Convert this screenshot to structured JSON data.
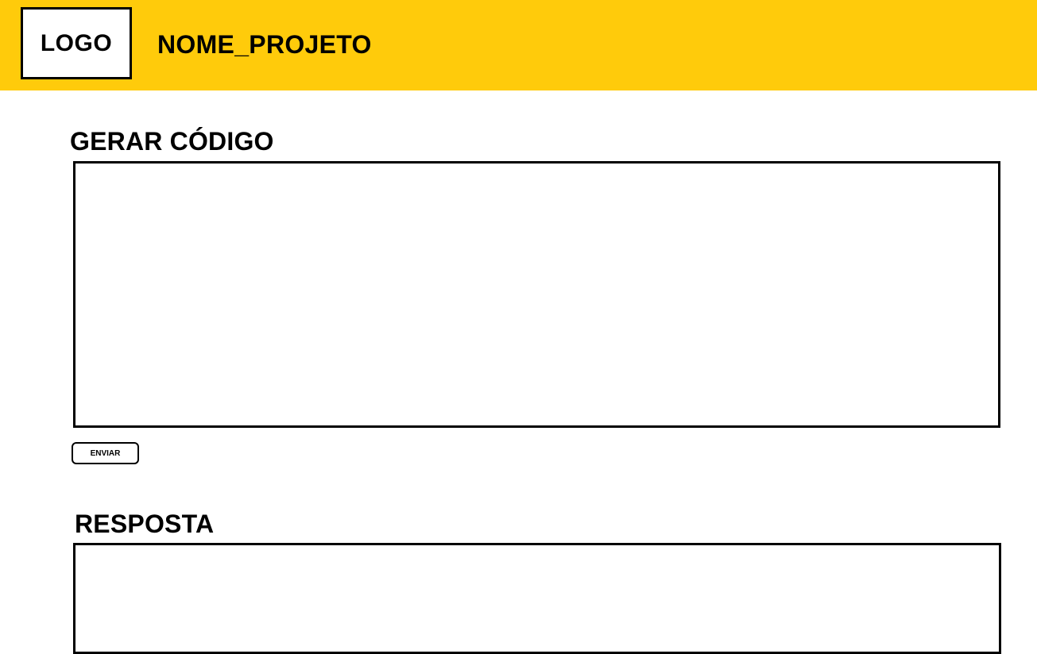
{
  "header": {
    "logo_text": "LOGO",
    "project_name": "NOME_PROJETO",
    "background_color": "#ffcb0b"
  },
  "generate_section": {
    "title": "GERAR CÓDIGO",
    "input_value": "",
    "send_label": "ENVIAR"
  },
  "response_section": {
    "title": "RESPOSTA",
    "output_value": ""
  }
}
